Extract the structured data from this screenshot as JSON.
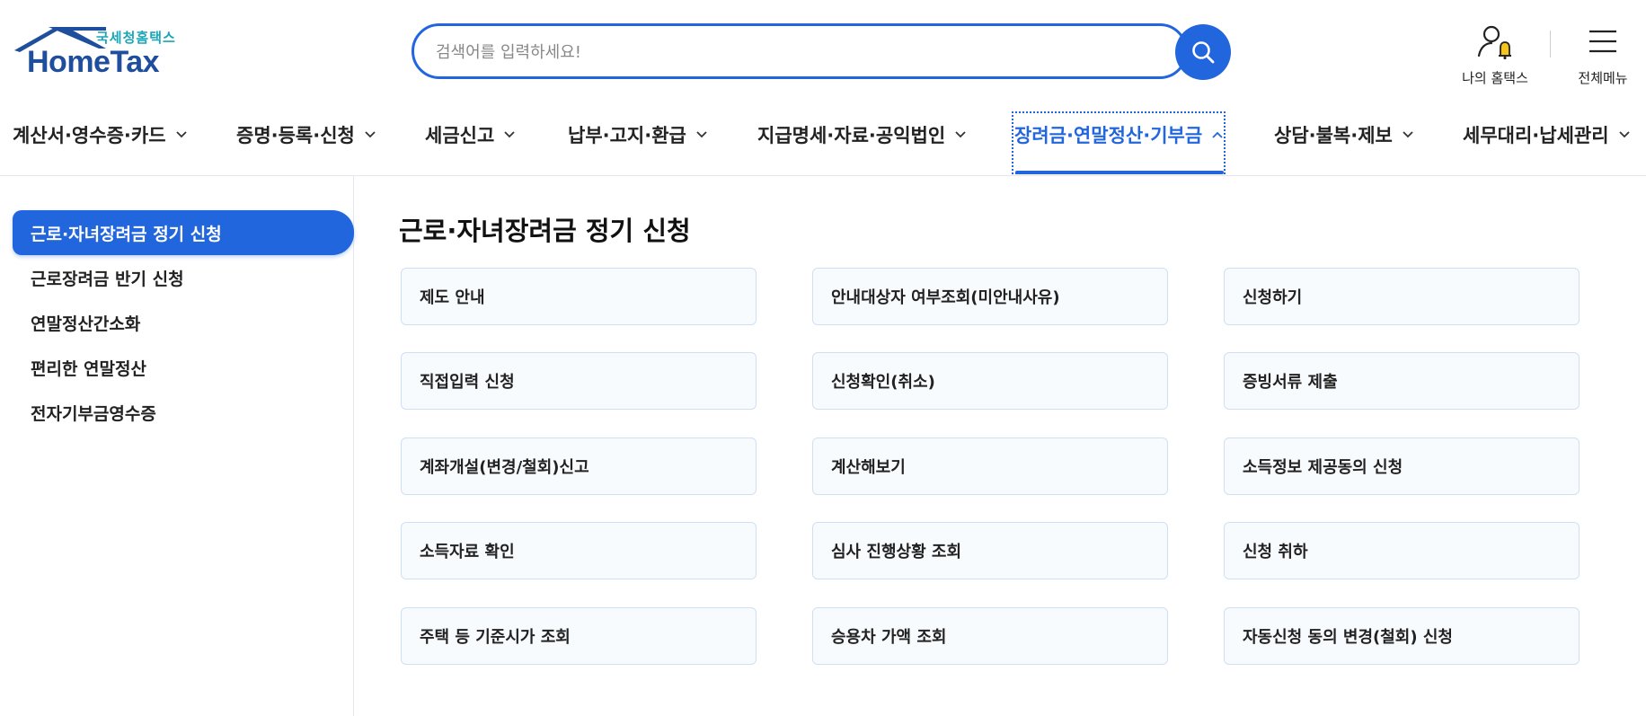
{
  "brand": {
    "sub_name": "국세청홈택스",
    "main_name": "HomeTax",
    "color": "#1f4e9c"
  },
  "search": {
    "placeholder": "검색어를 입력하세요!",
    "value": "",
    "icon": "search-icon"
  },
  "util": {
    "my_hometax": "나의 홈택스",
    "all_menu": "전체메뉴"
  },
  "gnb": {
    "items": [
      {
        "label": "계산서·영수증·카드"
      },
      {
        "label": "증명·등록·신청"
      },
      {
        "label": "세금신고"
      },
      {
        "label": "납부·고지·환급"
      },
      {
        "label": "지급명세·자료·공익법인"
      },
      {
        "label": "장려금·연말정산·기부금",
        "active": true
      },
      {
        "label": "상담·불복·제보"
      },
      {
        "label": "세무대리·납세관리"
      }
    ]
  },
  "sidebar": {
    "items": [
      {
        "label": "근로·자녀장려금 정기 신청",
        "active": true
      },
      {
        "label": "근로장려금 반기 신청"
      },
      {
        "label": "연말정산간소화"
      },
      {
        "label": "편리한 연말정산"
      },
      {
        "label": "전자기부금영수증"
      }
    ]
  },
  "main": {
    "title": "근로·자녀장려금 정기 신청",
    "cards": [
      [
        "제도 안내",
        "안내대상자 여부조회(미안내사유)",
        "신청하기"
      ],
      [
        "직접입력 신청",
        "신청확인(취소)",
        "증빙서류 제출"
      ],
      [
        "계좌개설(변경/철회)신고",
        "계산해보기",
        "소득정보 제공동의 신청"
      ],
      [
        "소득자료 확인",
        "심사 진행상황 조회",
        "신청 취하"
      ],
      [
        "주택 등 기준시가 조회",
        "승용차 가액 조회",
        "자동신청 동의 변경(철회) 신청"
      ]
    ]
  },
  "colors": {
    "accent": "#2266dd",
    "logo_sub": "#1aa6b7",
    "card_border": "#cfe0f4",
    "bell": "#f5c518"
  }
}
